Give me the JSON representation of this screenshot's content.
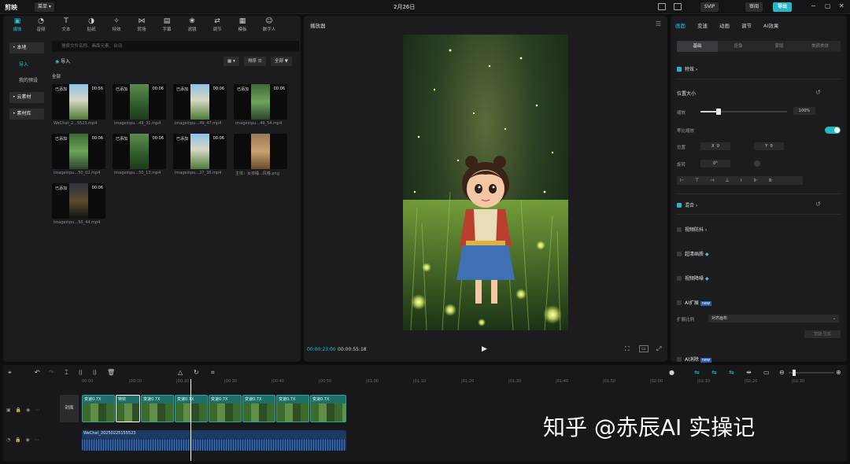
{
  "titlebar": {
    "app": "剪映",
    "menu": "菜单 ▾",
    "date": "2月26日",
    "svip": "SVIP",
    "share": "审阅",
    "export": "导出"
  },
  "media": {
    "tabs": [
      {
        "label": "媒体",
        "icon": "media-icon"
      },
      {
        "label": "音频",
        "icon": "audio-icon"
      },
      {
        "label": "文本",
        "icon": "text-icon"
      },
      {
        "label": "贴纸",
        "icon": "sticker-icon"
      },
      {
        "label": "特效",
        "icon": "effects-icon"
      },
      {
        "label": "转场",
        "icon": "transition-icon"
      },
      {
        "label": "字幕",
        "icon": "caption-icon"
      },
      {
        "label": "滤镜",
        "icon": "filter-icon"
      },
      {
        "label": "调节",
        "icon": "adjust-icon"
      },
      {
        "label": "模板",
        "icon": "template-icon"
      },
      {
        "label": "数字人",
        "icon": "avatar-icon"
      }
    ],
    "sidebar": {
      "local": "• 本地",
      "import": "导入",
      "presets": "我的预设",
      "cloud": "• 云素材",
      "library": "• 素材库"
    },
    "search_placeholder": "搜索文件名称、画面元素、台词",
    "import_btn": "导入",
    "sort_btn": "排序 ☰",
    "all_btn": "全部 ▼",
    "section_label": "全部",
    "items": [
      {
        "tag": "已添加",
        "dur": "00:56",
        "name": "WeChat_2...5523.mp4"
      },
      {
        "tag": "已添加",
        "dur": "00:06",
        "name": "imageinpu...49_31.mp4"
      },
      {
        "tag": "已添加",
        "dur": "00:06",
        "name": "imageinpu...49_47.mp4"
      },
      {
        "tag": "已添加",
        "dur": "00:06",
        "name": "imageinpu...49_54.mp4"
      },
      {
        "tag": "已添加",
        "dur": "00:06",
        "name": "imageinpu...50_02.mp4"
      },
      {
        "tag": "已添加",
        "dur": "00:06",
        "name": "imageinpu...50_13.mp4"
      },
      {
        "tag": "已添加",
        "dur": "00:06",
        "name": "imageinpu...27_36.mp4"
      },
      {
        "tag": "",
        "dur": "",
        "name": "主体：女孩睡...风格.png"
      },
      {
        "tag": "已添加",
        "dur": "00:06",
        "name": "imageinpu...50_44.mp4"
      }
    ]
  },
  "player": {
    "title": "播放器",
    "current": "00:00:23:00",
    "total": "00:00:55:18"
  },
  "inspector": {
    "tabs": [
      "画面",
      "变速",
      "动画",
      "调节",
      "AI效果"
    ],
    "segs": [
      "基础",
      "抠像",
      "蒙版",
      "美颜美体"
    ],
    "effects": "特效",
    "pos_size": "位置大小",
    "scale_label": "缩放",
    "scale_value": "100%",
    "scale_level": 1.0,
    "uniform": "等比缩放",
    "position_label": "位置",
    "x_value": "0",
    "y_value": "0",
    "rotate_label": "旋转",
    "rotate_value": "0°",
    "blend": "混合",
    "stabilize": "视频防抖",
    "hd": "超清画质",
    "denoise": "视频降噪",
    "ai_expand": "AI扩展",
    "expand_ratio": "扩展比例",
    "expand_value": "对齐画布",
    "gen": "智能·生成",
    "ai_remove": "AI消除"
  },
  "timeline": {
    "ruler": [
      "00:00",
      "|00:10",
      "|00:20",
      "|00:30",
      "|00:40",
      "|00:50",
      "|01:00",
      "|01:10",
      "|01:20",
      "|01:30",
      "|01:40",
      "|01:50",
      "|02:00",
      "|02:10",
      "|02:20",
      "|02:30"
    ],
    "cover": "封面",
    "clips": [
      "变速0.7X",
      "特效",
      "变速0.7X",
      "变速0.7X",
      "变速0.7X",
      "变速0.7X",
      "变速0.7X",
      "变速0.7X"
    ],
    "audio": "WeChat_20250225155523"
  },
  "watermark": "知乎 @赤辰AI 实操记"
}
